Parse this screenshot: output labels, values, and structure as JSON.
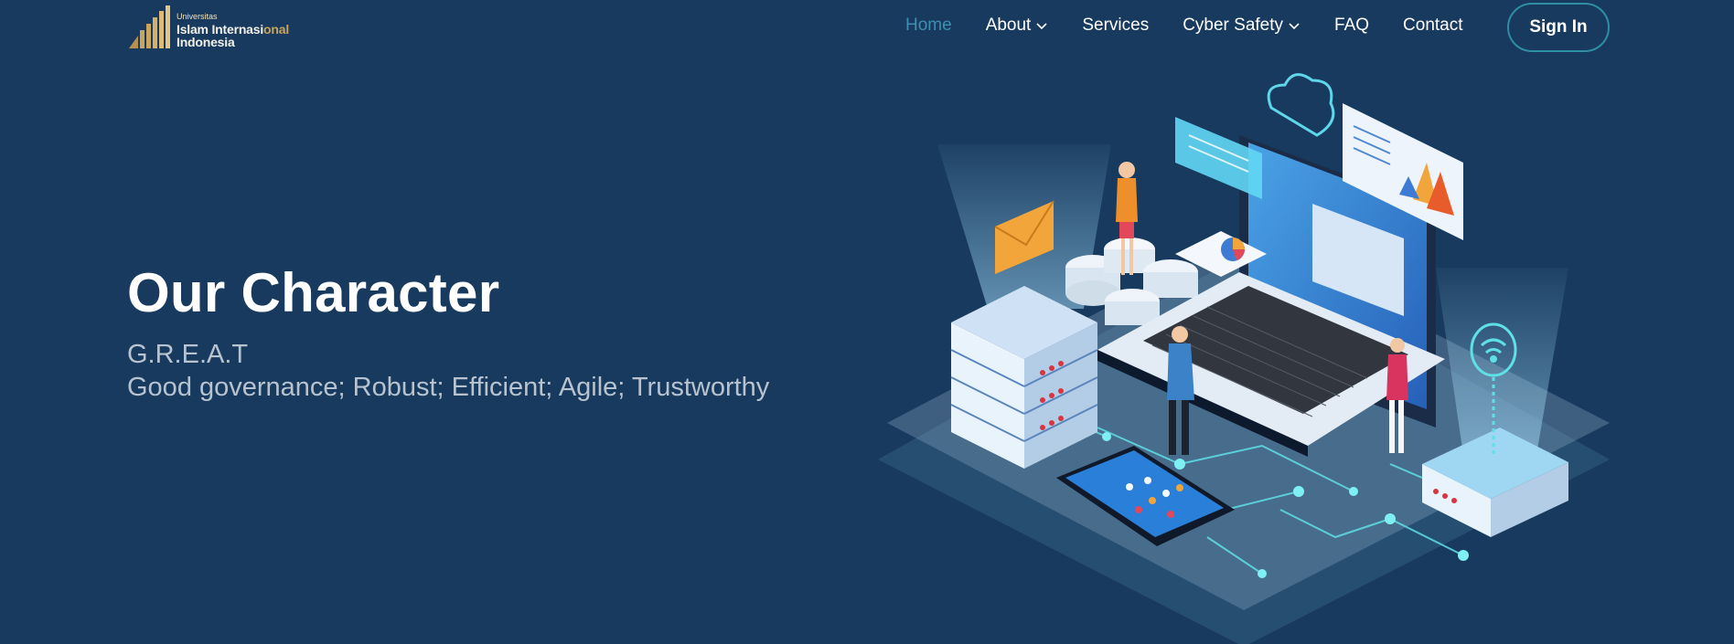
{
  "brand": {
    "logo_small": "Universitas",
    "logo_line1_a": "Islam Internasi",
    "logo_line1_b": "onal",
    "logo_line2": "Indonesia"
  },
  "nav": {
    "items": [
      {
        "label": "Home",
        "active": true
      },
      {
        "label": "About",
        "dropdown": true
      },
      {
        "label": "Services"
      },
      {
        "label": "Cyber Safety",
        "dropdown": true
      },
      {
        "label": "FAQ"
      },
      {
        "label": "Contact"
      }
    ],
    "signin_label": "Sign In"
  },
  "hero": {
    "title": "Our Character",
    "subtitle": "G.R.E.A.T",
    "values": "Good governance; Robust; Efficient; Agile; Trustworthy"
  },
  "colors": {
    "background": "#173a5e",
    "active_nav": "#3e8fb1",
    "signin_border": "#2f8ea4",
    "subtitle_text": "#b7c3d0",
    "logo_gold": "#c9a45c"
  },
  "icons": [
    "logo-mark-icon",
    "chevron-down-icon",
    "cloud-icon",
    "envelope-icon",
    "wifi-icon",
    "pie-chart-icon"
  ]
}
